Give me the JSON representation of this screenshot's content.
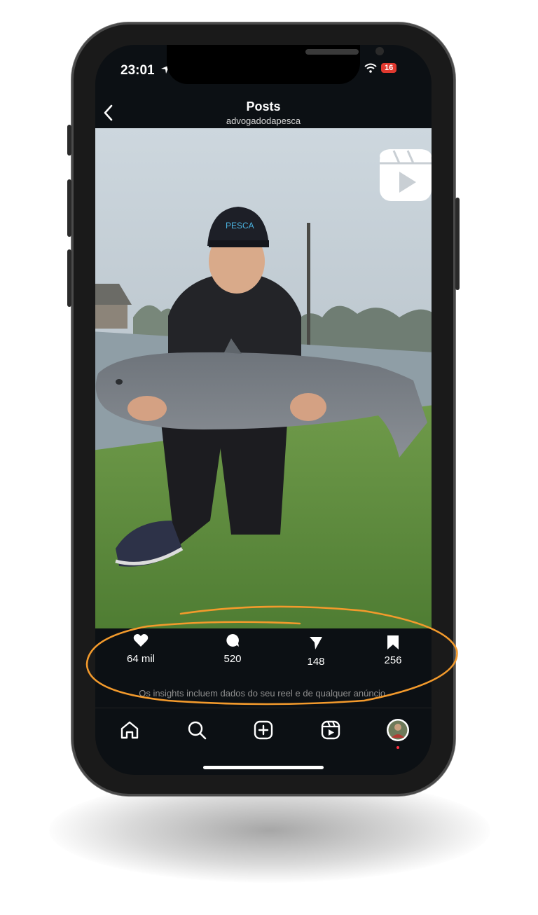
{
  "status_bar": {
    "time": "23:01",
    "battery_level": "16"
  },
  "header": {
    "title": "Posts",
    "username": "advogadodapesca"
  },
  "photo": {
    "cap_text": "PESCA"
  },
  "stats": {
    "likes": "64 mil",
    "comments": "520",
    "shares": "148",
    "saves": "256"
  },
  "insights_note": "Os insights incluem dados do seu reel e de qualquer anúncio.",
  "tabbar": {
    "items": [
      "home-icon",
      "search-icon",
      "create-icon",
      "reels-icon",
      "profile-avatar"
    ]
  },
  "colors": {
    "annotation": "#f39a2c",
    "screen_bg": "#0c1014",
    "battery_red": "#e0392f"
  }
}
